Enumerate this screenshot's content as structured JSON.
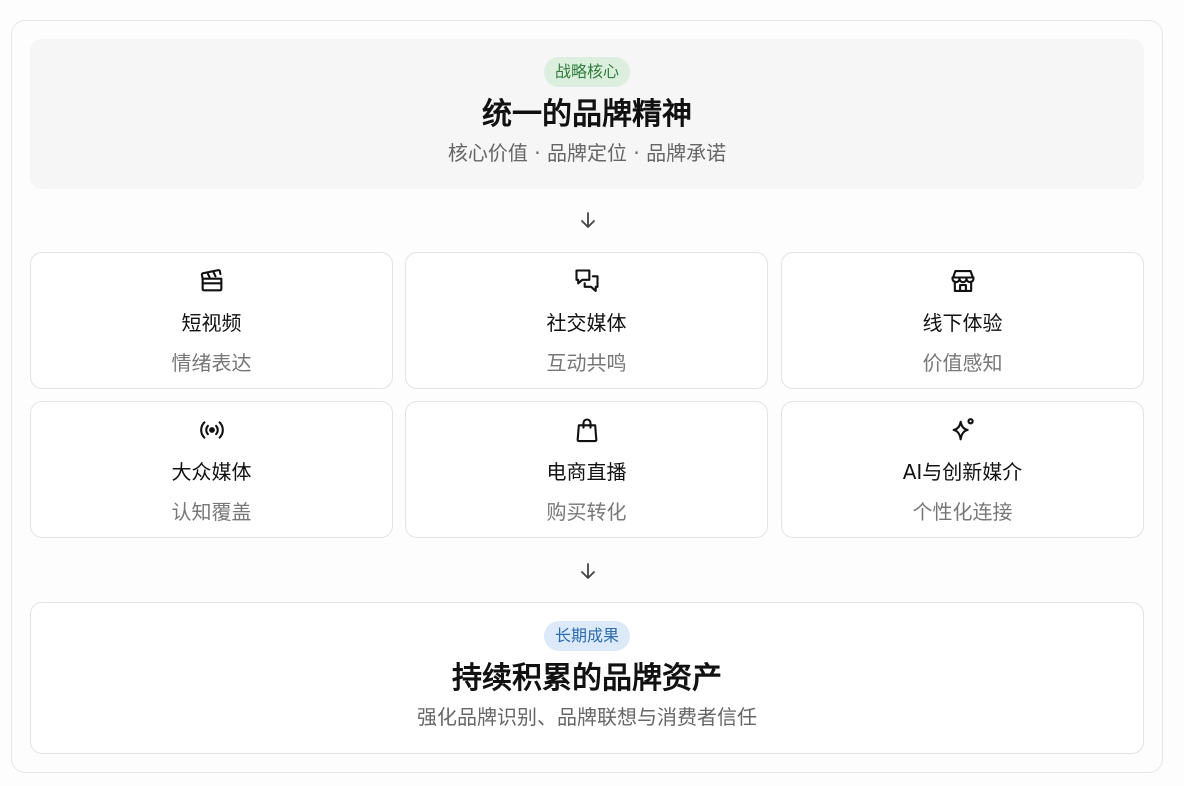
{
  "top": {
    "badge": "战略核心",
    "title": "统一的品牌精神",
    "subtitle": "核心价值 · 品牌定位 · 品牌承诺"
  },
  "channels": [
    {
      "icon": "clapperboard-icon",
      "name": "短视频",
      "desc": "情绪表达"
    },
    {
      "icon": "chat-bubbles-icon",
      "name": "社交媒体",
      "desc": "互动共鸣"
    },
    {
      "icon": "storefront-icon",
      "name": "线下体验",
      "desc": "价值感知"
    },
    {
      "icon": "broadcast-icon",
      "name": "大众媒体",
      "desc": "认知覆盖"
    },
    {
      "icon": "shopping-bag-icon",
      "name": "电商直播",
      "desc": "购买转化"
    },
    {
      "icon": "sparkle-icon",
      "name": "AI与创新媒介",
      "desc": "个性化连接"
    }
  ],
  "bottom": {
    "badge": "长期成果",
    "title": "持续积累的品牌资产",
    "subtitle": "强化品牌识别、品牌联想与消费者信任"
  },
  "colors": {
    "badge_green_bg": "#dcefdf",
    "badge_green_text": "#2f7d3a",
    "badge_blue_bg": "#dce9f8",
    "badge_blue_text": "#2b6cb0"
  }
}
